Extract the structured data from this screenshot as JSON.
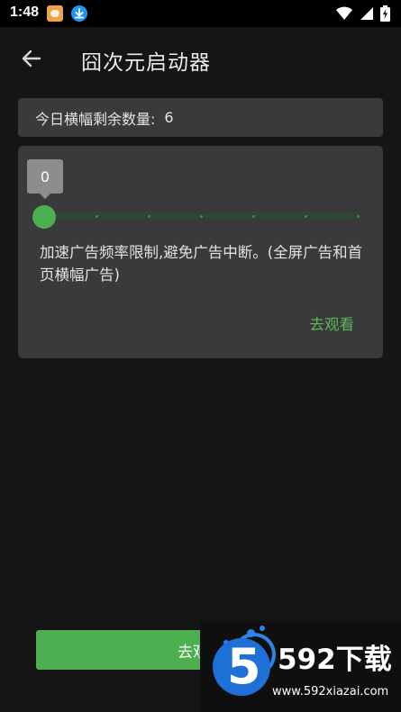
{
  "status_bar": {
    "time": "1:48",
    "icons": [
      "app-notification-icon",
      "download-icon",
      "wifi-icon",
      "signal-icon",
      "battery-charging-icon"
    ]
  },
  "app_bar": {
    "title": "囧次元启动器",
    "back_icon": "arrow-left-icon"
  },
  "quota": {
    "label": "今日横幅剩余数量:",
    "value": "6"
  },
  "slider": {
    "value": "0",
    "level_fraction": 0.0,
    "accent": "#4caf50"
  },
  "card": {
    "description": "加速广告频率限制,避免广告中断。(全屏广告和首页横幅广告)",
    "watch_link": "去观看"
  },
  "bottom_button": {
    "label": "去观看"
  },
  "watermark": {
    "digit": "5",
    "brand": "592下载",
    "url": "www.592xiazai.com"
  },
  "colors": {
    "background": "#151515",
    "card": "#3a3a3a",
    "accent_green": "#4caf50",
    "link_green": "#5cb85c"
  }
}
